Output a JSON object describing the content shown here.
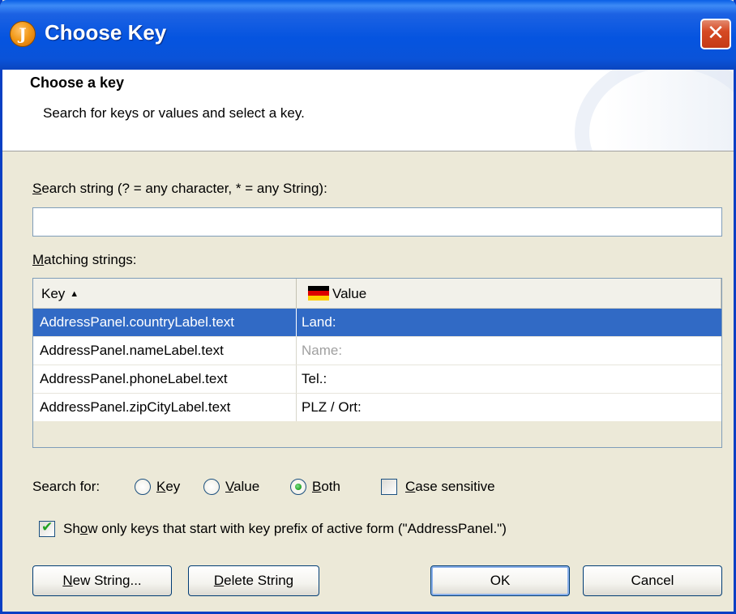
{
  "window": {
    "title": "Choose Key",
    "app_icon_letter": "J",
    "close_glyph": "✕"
  },
  "header": {
    "title": "Choose a key",
    "description": "Search for keys or values and select a key."
  },
  "search": {
    "label_mnemonic": "S",
    "label_rest": "earch string (? = any character, * = any String):",
    "value": "",
    "placeholder": ""
  },
  "matching": {
    "label_mnemonic": "M",
    "label_rest": "atching strings:"
  },
  "table": {
    "columns": {
      "key": "Key",
      "key_sort_glyph": "▲",
      "value": "Value",
      "value_icon": "german-flag-icon"
    },
    "rows": [
      {
        "key": "AddressPanel.countryLabel.text",
        "value": "Land:",
        "selected": true
      },
      {
        "key": "AddressPanel.nameLabel.text",
        "value": "Name:",
        "selected": false
      },
      {
        "key": "AddressPanel.phoneLabel.text",
        "value": "Tel.:",
        "selected": false
      },
      {
        "key": "AddressPanel.zipCityLabel.text",
        "value": "PLZ / Ort:",
        "selected": false
      }
    ]
  },
  "search_for": {
    "label": "Search for:",
    "options": [
      {
        "mnemonic": "K",
        "rest": "ey",
        "checked": false
      },
      {
        "mnemonic": "V",
        "rest": "alue",
        "checked": false
      },
      {
        "mnemonic": "B",
        "rest": "oth",
        "checked": true
      }
    ],
    "case_sensitive": {
      "mnemonic": "C",
      "rest": "ase sensitive",
      "checked": false
    }
  },
  "show_only": {
    "pre": "Sh",
    "mnemonic": "o",
    "rest": "w only keys that start with key prefix of active form (\"AddressPanel.\")",
    "checked": true
  },
  "buttons": {
    "new_string": {
      "mnemonic": "N",
      "rest": "ew String..."
    },
    "delete_string": {
      "mnemonic": "D",
      "rest": "elete String"
    },
    "ok": "OK",
    "cancel": "Cancel"
  },
  "colors": {
    "titlebar": "#0554e0",
    "selection": "#316ac5",
    "dialog_bg": "#ece9d8",
    "close_red": "#d64a24"
  }
}
